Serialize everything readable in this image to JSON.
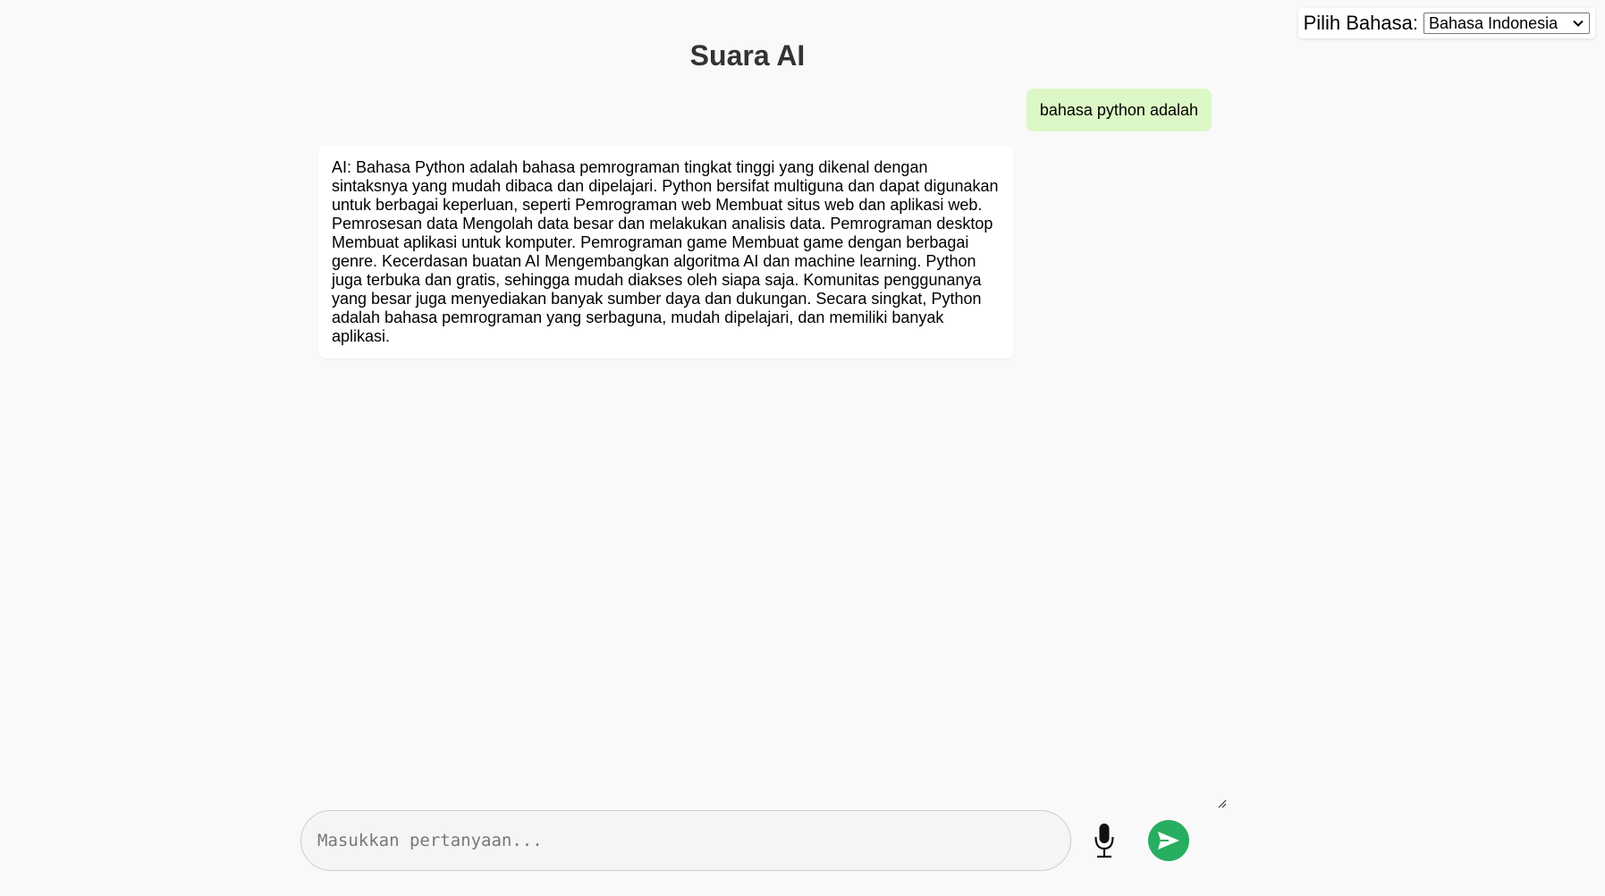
{
  "language": {
    "label": "Pilih Bahasa:",
    "selected": "Bahasa Indonesia",
    "icon": "chevron-down-icon"
  },
  "header": {
    "title": "Suara AI"
  },
  "conversation": {
    "messages": [
      {
        "role": "user",
        "text": "bahasa python adalah"
      },
      {
        "role": "ai",
        "text": "AI: Bahasa Python adalah bahasa pemrograman tingkat tinggi yang dikenal dengan sintaksnya yang mudah dibaca dan dipelajari. Python bersifat multiguna dan dapat digunakan untuk berbagai keperluan, seperti Pemrograman web Membuat situs web dan aplikasi web. Pemrosesan data Mengolah data besar dan melakukan analisis data. Pemrograman desktop Membuat aplikasi untuk komputer. Pemrograman game Membuat game dengan berbagai genre. Kecerdasan buatan AI Mengembangkan algoritma AI dan machine learning. Python juga terbuka dan gratis, sehingga mudah diakses oleh siapa saja. Komunitas penggunanya yang besar juga menyediakan banyak sumber daya dan dukungan. Secara singkat, Python adalah bahasa pemrograman yang serbaguna, mudah dipelajari, dan memiliki banyak aplikasi."
      }
    ]
  },
  "composer": {
    "placeholder": "Masukkan pertanyaan...",
    "value": "",
    "mic_icon": "microphone-icon",
    "send_icon": "send-icon",
    "send_color": "#27ae60",
    "user_bubble_color": "#dcf8c6"
  }
}
